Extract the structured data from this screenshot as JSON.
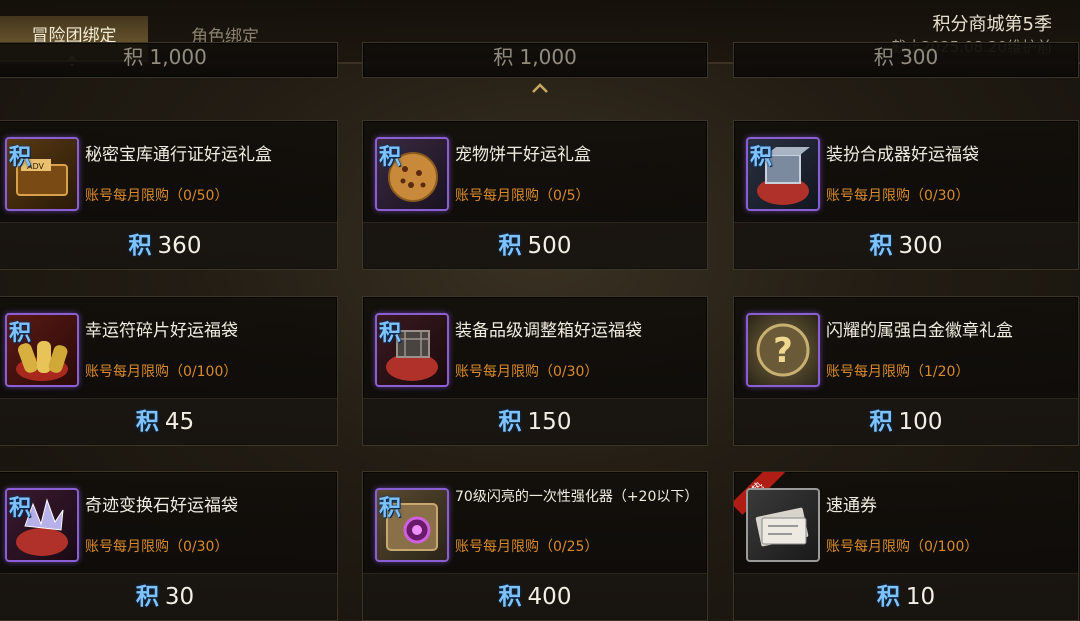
{
  "tabs": [
    {
      "label": "冒险团绑定",
      "active": true
    },
    {
      "label": "角色绑定",
      "active": false
    }
  ],
  "header": {
    "title": "积分商城第5季",
    "deadline": "截止2025.08.20维护前"
  },
  "currency_symbol": "积",
  "partial_row": [
    {
      "price": "1,000"
    },
    {
      "price": "1,000"
    },
    {
      "price": "300"
    }
  ],
  "items": [
    {
      "name": "秘密宝库通行证好运礼盒",
      "limit": "账号每月限购（0/50）",
      "price": "360",
      "icon": "pass-box-icon"
    },
    {
      "name": "宠物饼干好运礼盒",
      "limit": "账号每月限购（0/5）",
      "price": "500",
      "icon": "cookie-icon"
    },
    {
      "name": "装扮合成器好运福袋",
      "limit": "账号每月限购（0/30）",
      "price": "300",
      "icon": "synthesizer-bag-icon"
    },
    {
      "name": "幸运符碎片好运福袋",
      "limit": "账号每月限购（0/100）",
      "price": "45",
      "icon": "charm-scroll-icon"
    },
    {
      "name": "装备品级调整箱好运福袋",
      "limit": "账号每月限购（0/30）",
      "price": "150",
      "icon": "adjust-box-bag-icon"
    },
    {
      "name": "闪耀的属强白金徽章礼盒",
      "limit": "账号每月限购（1/20）",
      "price": "100",
      "icon": "mystery-badge-icon"
    },
    {
      "name": "奇迹变换石好运福袋",
      "limit": "账号每月限购（0/30）",
      "price": "30",
      "icon": "crystal-bag-icon"
    },
    {
      "name": "70级闪亮的一次性强化器（+20以下）",
      "limit": "账号每月限购（0/25）",
      "price": "400",
      "icon": "enhancer-icon"
    },
    {
      "name": "速通券",
      "limit": "账号每月限购（0/100）",
      "price": "10",
      "icon": "ticket-icon",
      "hot": "热"
    }
  ],
  "colors": {
    "accent_gold": "#d7b46a",
    "limit_orange": "#d98a2d",
    "currency_blue": "#7ec3ff",
    "icon_border_purple": "#8a5fd3"
  }
}
